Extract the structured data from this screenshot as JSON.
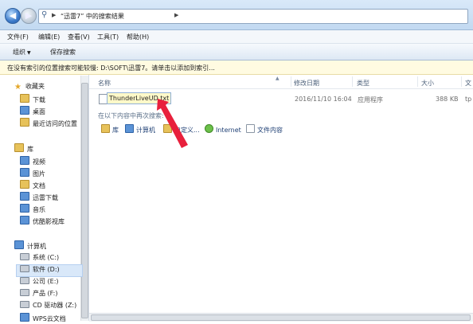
{
  "address": {
    "path": "“迅雷7” 中的搜索结果"
  },
  "menu": [
    "文件(F)",
    "编辑(E)",
    "查看(V)",
    "工具(T)",
    "帮助(H)"
  ],
  "toolbar": {
    "organize": "组织",
    "save_search": "保存搜索"
  },
  "infobar": {
    "text": "在没有索引的位置搜索可能较慢: D:\\SOFT\\迅雷7。请单击以添加到索引..."
  },
  "nav": {
    "favorites": "收藏夹",
    "fav_items": [
      "下载",
      "桌面",
      "最近访问的位置"
    ],
    "libraries": "库",
    "lib_items": [
      "视频",
      "图片",
      "文档",
      "迅雷下载",
      "音乐",
      "优酷影视库"
    ],
    "computer": "计算机",
    "drives": [
      "系统 (C:)",
      "软件 (D:)",
      "公司 (E:)",
      "产品 (F:)",
      "CD 驱动器 (Z:)",
      "WPS云文档"
    ]
  },
  "columns": {
    "name": "名称",
    "modified": "修改日期",
    "type": "类型",
    "size": "大小",
    "folder": "文"
  },
  "file": {
    "name": "ThunderLiveUD.txt",
    "modified": "2016/11/10 16:04",
    "type": "应用程序",
    "size": "388 KB",
    "folder": "tp"
  },
  "search_again": {
    "label": "在以下内容中再次搜索:",
    "items": [
      "库",
      "计算机",
      "自定义...",
      "Internet",
      "文件内容"
    ]
  },
  "colors": {
    "annotation_arrow": "#e8203c",
    "highlight": "#fff9c9"
  }
}
